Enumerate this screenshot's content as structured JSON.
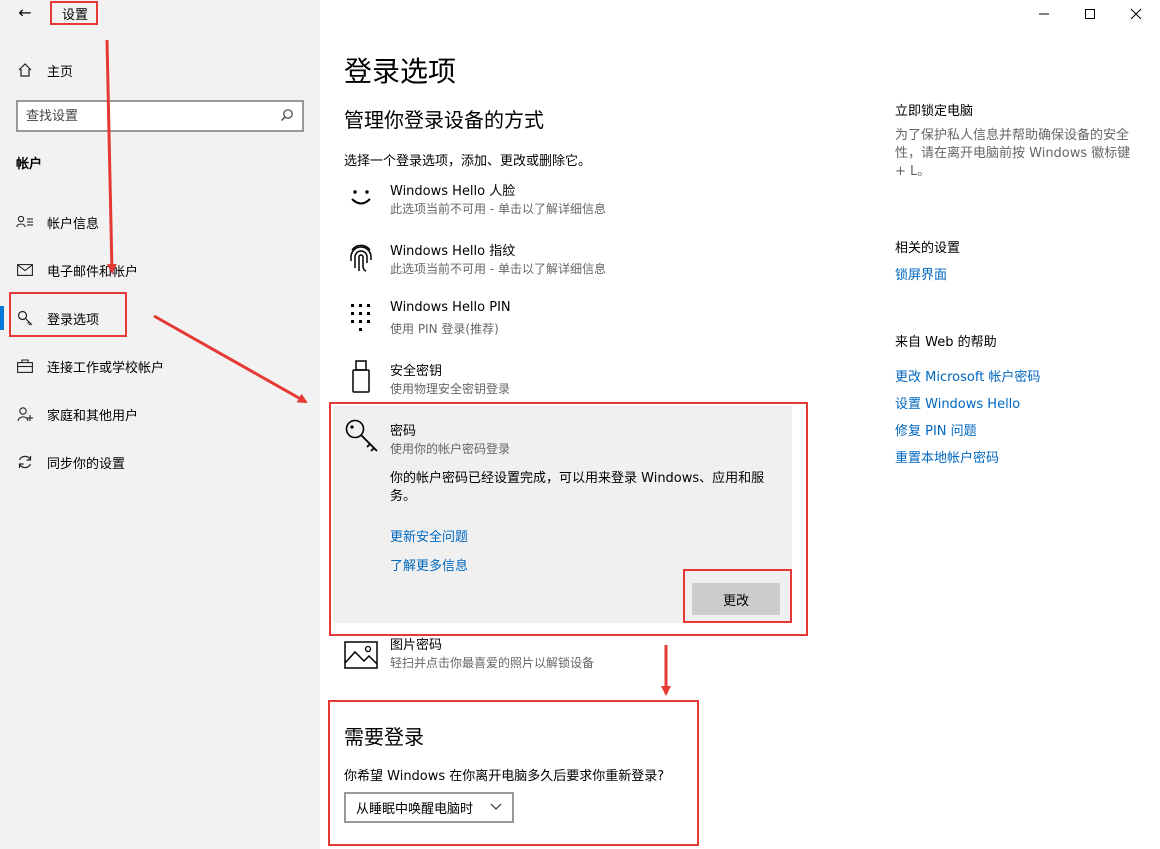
{
  "window": {
    "title": "设置",
    "back_icon": "arrow-left-icon",
    "controls": [
      "minimize-icon",
      "maximize-icon",
      "close-icon"
    ]
  },
  "sidebar": {
    "home_label": "主页",
    "search_placeholder": "查找设置",
    "section_title": "帐户",
    "items": [
      {
        "label": "帐户信息",
        "icon": "account-info-icon"
      },
      {
        "label": "电子邮件和帐户",
        "icon": "mail-icon"
      },
      {
        "label": "登录选项",
        "icon": "key-icon",
        "active": true
      },
      {
        "label": "连接工作或学校帐户",
        "icon": "briefcase-icon"
      },
      {
        "label": "家庭和其他用户",
        "icon": "person-add-icon"
      },
      {
        "label": "同步你的设置",
        "icon": "sync-icon"
      }
    ]
  },
  "main": {
    "title": "登录选项",
    "subtitle": "管理你登录设备的方式",
    "description": "选择一个登录选项，添加、更改或删除它。",
    "options": [
      {
        "title": "Windows Hello 人脸",
        "subtitle": "此选项当前不可用 - 单击以了解详细信息",
        "icon": "smile-face-icon"
      },
      {
        "title": "Windows Hello 指纹",
        "subtitle": "此选项当前不可用 - 单击以了解详细信息",
        "icon": "fingerprint-icon"
      },
      {
        "title": "Windows Hello PIN",
        "subtitle": "使用 PIN 登录(推荐)",
        "icon": "pin-keypad-icon"
      },
      {
        "title": "安全密钥",
        "subtitle": "使用物理安全密钥登录",
        "icon": "usb-key-icon"
      }
    ],
    "password": {
      "title": "密码",
      "subtitle": "使用你的帐户密码登录",
      "body": "你的帐户密码已经设置完成，可以用来登录 Windows、应用和服务。",
      "link1": "更新安全问题",
      "link2": "了解更多信息",
      "button": "更改"
    },
    "picture_password": {
      "title": "图片密码",
      "subtitle": "轻扫并点击你最喜爱的照片以解锁设备",
      "icon": "picture-icon"
    },
    "require_signin": {
      "title": "需要登录",
      "question": "你希望 Windows 在你离开电脑多久后要求你重新登录?",
      "selected": "从睡眠中唤醒电脑时"
    }
  },
  "right": {
    "lock_title": "立即锁定电脑",
    "lock_text": "为了保护私人信息并帮助确保设备的安全性，请在离开电脑前按 Windows 徽标键 + L。",
    "related_title": "相关的设置",
    "related_link": "锁屏界面",
    "help_title": "来自 Web 的帮助",
    "help_links": [
      "更改 Microsoft 帐户密码",
      "设置 Windows Hello",
      "修复 PIN 问题",
      "重置本地帐户密码"
    ]
  },
  "colors": {
    "accent": "#0078d7",
    "link": "#0067c0",
    "annotation": "#e53935"
  }
}
